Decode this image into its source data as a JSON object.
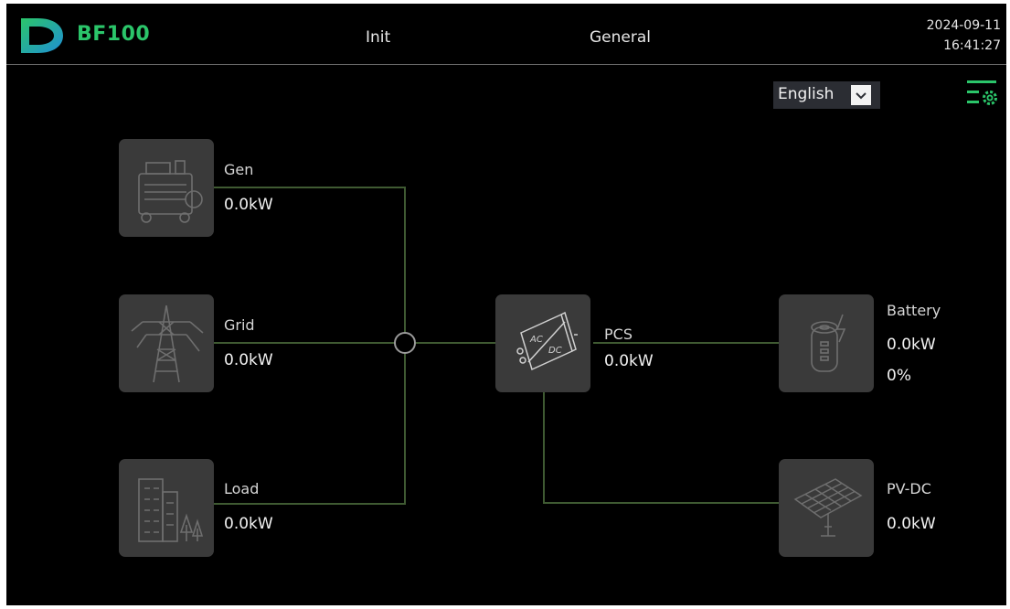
{
  "header": {
    "brand": "BF100",
    "nav_init": "Init",
    "nav_general": "General",
    "date": "2024-09-11",
    "time": "16:41:27"
  },
  "language": {
    "selected": "English"
  },
  "icons": {
    "logo": "brand-logo-d",
    "settings": "settings-list-icon",
    "language_arrow": "chevron-down-icon"
  },
  "colors": {
    "background": "#000000",
    "brand_green": "#2bc56a",
    "tile": "#3a3a3a",
    "flow_line": "#3f5a32"
  },
  "nodes": {
    "gen": {
      "label": "Gen",
      "power": "0.0kW"
    },
    "grid": {
      "label": "Grid",
      "power": "0.0kW"
    },
    "load": {
      "label": "Load",
      "power": "0.0kW"
    },
    "pcs": {
      "label": "PCS",
      "power": "0.0kW"
    },
    "battery": {
      "label": "Battery",
      "power": "0.0kW",
      "soc": "0%"
    },
    "pvdc": {
      "label": "PV-DC",
      "power": "0.0kW"
    }
  }
}
